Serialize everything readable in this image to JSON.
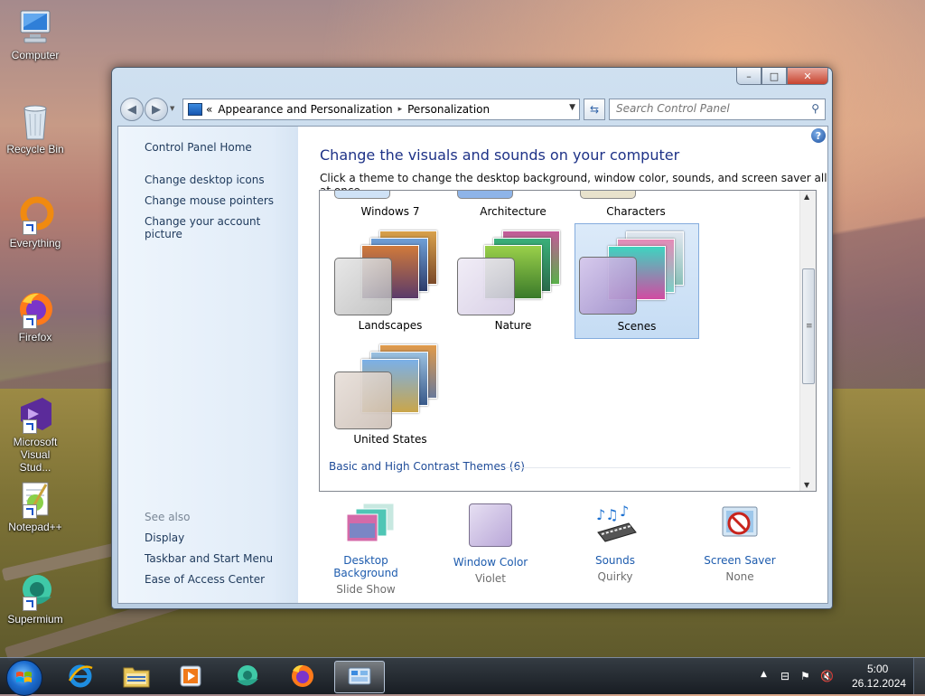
{
  "desktop": {
    "icons": [
      {
        "label": "Computer"
      },
      {
        "label": "Recycle Bin"
      },
      {
        "label": "Everything"
      },
      {
        "label": "Firefox"
      },
      {
        "label": "Microsoft Visual Stud..."
      },
      {
        "label": "Notepad++"
      },
      {
        "label": "Supermium"
      }
    ]
  },
  "window": {
    "buttons": {
      "minimize": "–",
      "maximize": "□",
      "close": "✕"
    },
    "breadcrumb": {
      "chevrons": "«",
      "items": [
        "Appearance and Personalization",
        "Personalization"
      ],
      "separator": "▸"
    },
    "search": {
      "placeholder": "Search Control Panel"
    },
    "left_pane": {
      "home": "Control Panel Home",
      "tasks": [
        "Change desktop icons",
        "Change mouse pointers",
        "Change your account picture"
      ],
      "see_also_heading": "See also",
      "see_also": [
        "Display",
        "Taskbar and Start Menu",
        "Ease of Access Center"
      ]
    },
    "main": {
      "title": "Change the visuals and sounds on your computer",
      "subtitle": "Click a theme to change the desktop background, window color, sounds, and screen saver all at once.",
      "help": "?",
      "themes_top_row": [
        "Windows 7",
        "Architecture",
        "Characters"
      ],
      "themes": [
        {
          "name": "Landscapes",
          "selected": false
        },
        {
          "name": "Nature",
          "selected": false
        },
        {
          "name": "Scenes",
          "selected": true
        },
        {
          "name": "United States",
          "selected": false
        }
      ],
      "group_link": "Basic and High Contrast Themes (6)",
      "bottom_items": [
        {
          "label": "Desktop Background",
          "value": "Slide Show"
        },
        {
          "label": "Window Color",
          "value": "Violet"
        },
        {
          "label": "Sounds",
          "value": "Quirky"
        },
        {
          "label": "Screen Saver",
          "value": "None"
        }
      ]
    }
  },
  "taskbar": {
    "clock": {
      "time": "5:00",
      "date": "26.12.2024"
    }
  },
  "colors": {
    "link": "#1e395b",
    "title": "#1e3287",
    "selection": "#c5dcf4",
    "accent_blue": "#1e5cae"
  }
}
